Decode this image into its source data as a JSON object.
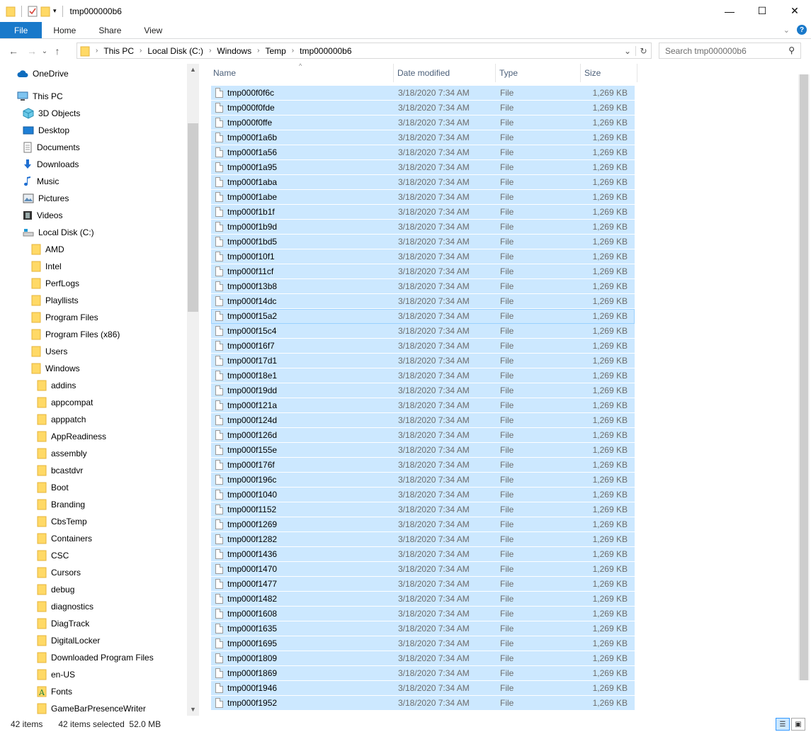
{
  "window": {
    "title": "tmp000000b6",
    "minimize": "—",
    "maximize": "☐",
    "close": "✕"
  },
  "ribbon": {
    "tabs": [
      "File",
      "Home",
      "Share",
      "View"
    ],
    "help": "?"
  },
  "address": {
    "crumbs": [
      "This PC",
      "Local Disk (C:)",
      "Windows",
      "Temp",
      "tmp000000b6"
    ],
    "search_placeholder": "Search tmp000000b6"
  },
  "nav": {
    "items": [
      {
        "label": "OneDrive",
        "icon": "cloud-icon"
      },
      {
        "label": "This PC",
        "icon": "computer-icon"
      },
      {
        "label": "3D Objects",
        "icon": "cube-icon"
      },
      {
        "label": "Desktop",
        "icon": "desktop-icon"
      },
      {
        "label": "Documents",
        "icon": "document-icon"
      },
      {
        "label": "Downloads",
        "icon": "download-icon"
      },
      {
        "label": "Music",
        "icon": "music-icon"
      },
      {
        "label": "Pictures",
        "icon": "picture-icon"
      },
      {
        "label": "Videos",
        "icon": "video-icon"
      },
      {
        "label": "Local Disk (C:)",
        "icon": "drive-icon"
      },
      {
        "label": "AMD",
        "icon": "folder-icon"
      },
      {
        "label": "Intel",
        "icon": "folder-icon"
      },
      {
        "label": "PerfLogs",
        "icon": "folder-icon"
      },
      {
        "label": "Playllists",
        "icon": "folder-icon"
      },
      {
        "label": "Program Files",
        "icon": "folder-icon"
      },
      {
        "label": "Program Files (x86)",
        "icon": "folder-icon"
      },
      {
        "label": "Users",
        "icon": "folder-icon"
      },
      {
        "label": "Windows",
        "icon": "folder-icon"
      },
      {
        "label": "addins",
        "icon": "folder-icon"
      },
      {
        "label": "appcompat",
        "icon": "folder-icon"
      },
      {
        "label": "apppatch",
        "icon": "folder-icon"
      },
      {
        "label": "AppReadiness",
        "icon": "folder-icon"
      },
      {
        "label": "assembly",
        "icon": "folder-icon"
      },
      {
        "label": "bcastdvr",
        "icon": "folder-icon"
      },
      {
        "label": "Boot",
        "icon": "folder-icon"
      },
      {
        "label": "Branding",
        "icon": "folder-icon"
      },
      {
        "label": "CbsTemp",
        "icon": "folder-icon"
      },
      {
        "label": "Containers",
        "icon": "folder-icon"
      },
      {
        "label": "CSC",
        "icon": "folder-icon"
      },
      {
        "label": "Cursors",
        "icon": "folder-icon"
      },
      {
        "label": "debug",
        "icon": "folder-icon"
      },
      {
        "label": "diagnostics",
        "icon": "folder-icon"
      },
      {
        "label": "DiagTrack",
        "icon": "folder-icon"
      },
      {
        "label": "DigitalLocker",
        "icon": "folder-icon"
      },
      {
        "label": "Downloaded Program Files",
        "icon": "folder-icon"
      },
      {
        "label": "en-US",
        "icon": "folder-icon"
      },
      {
        "label": "Fonts",
        "icon": "fonts-icon"
      },
      {
        "label": "GameBarPresenceWriter",
        "icon": "folder-icon"
      }
    ]
  },
  "columns": [
    "Name",
    "Date modified",
    "Type",
    "Size"
  ],
  "files": [
    "tmp000f0f6c",
    "tmp000f0fde",
    "tmp000f0ffe",
    "tmp000f1a6b",
    "tmp000f1a56",
    "tmp000f1a95",
    "tmp000f1aba",
    "tmp000f1abe",
    "tmp000f1b1f",
    "tmp000f1b9d",
    "tmp000f1bd5",
    "tmp000f10f1",
    "tmp000f11cf",
    "tmp000f13b8",
    "tmp000f14dc",
    "tmp000f15a2",
    "tmp000f15c4",
    "tmp000f16f7",
    "tmp000f17d1",
    "tmp000f18e1",
    "tmp000f19dd",
    "tmp000f121a",
    "tmp000f124d",
    "tmp000f126d",
    "tmp000f155e",
    "tmp000f176f",
    "tmp000f196c",
    "tmp000f1040",
    "tmp000f1152",
    "tmp000f1269",
    "tmp000f1282",
    "tmp000f1436",
    "tmp000f1470",
    "tmp000f1477",
    "tmp000f1482",
    "tmp000f1608",
    "tmp000f1635",
    "tmp000f1695",
    "tmp000f1809",
    "tmp000f1869",
    "tmp000f1946",
    "tmp000f1952"
  ],
  "file_date": "3/18/2020 7:34 AM",
  "file_type": "File",
  "file_size": "1,269 KB",
  "status": {
    "count": "42 items",
    "selected": "42 items selected  52.0 MB"
  }
}
